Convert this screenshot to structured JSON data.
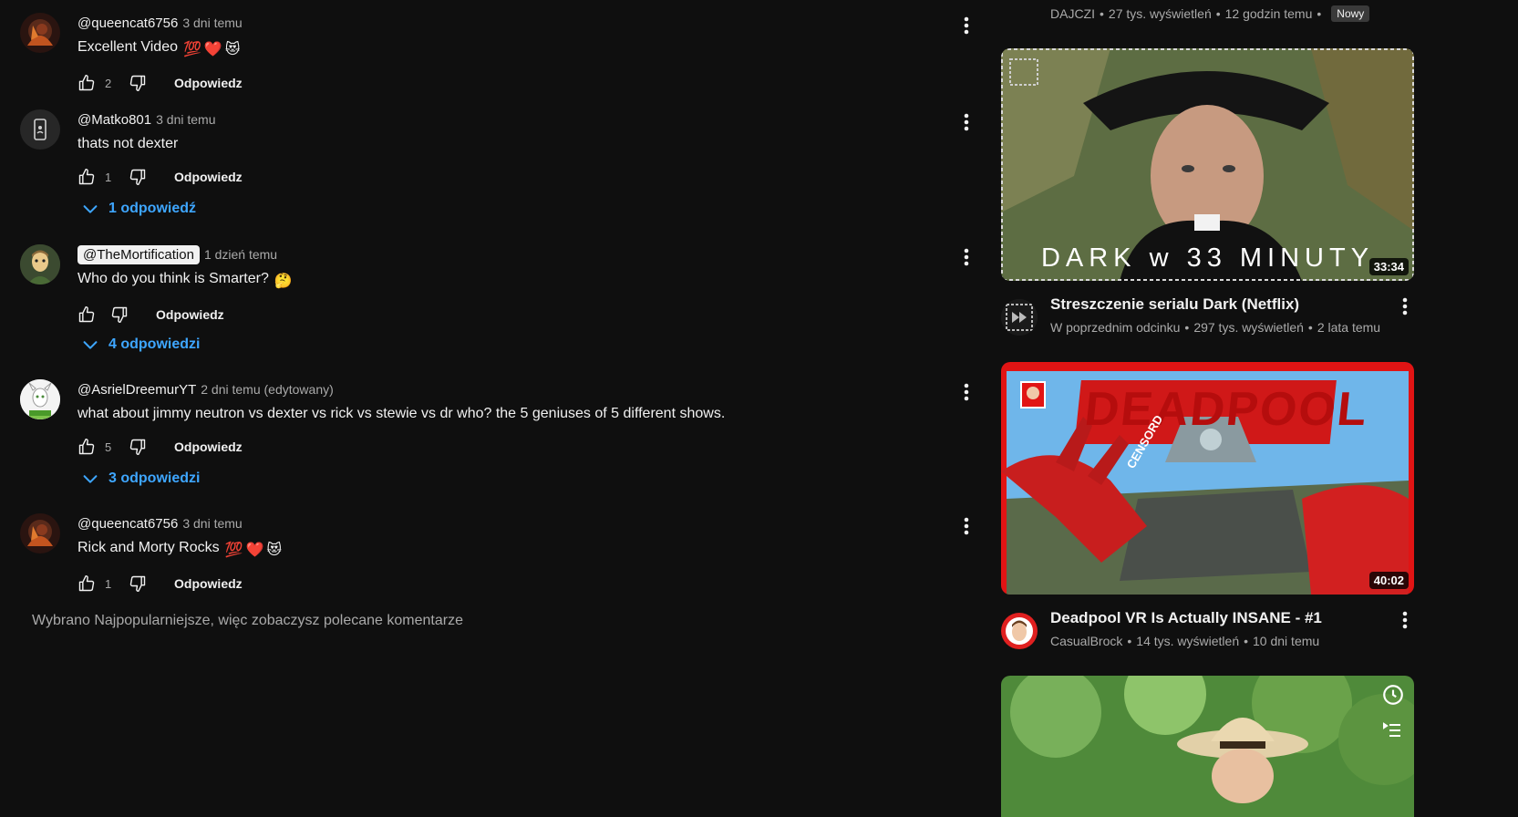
{
  "comments": [
    {
      "author": "@queencat6756",
      "time": "3 dni temu",
      "text": "Excellent Video",
      "emojis": [
        "💯",
        "❤️",
        "😻"
      ],
      "likes": "2",
      "reply_label": "Odpowiedz"
    },
    {
      "author": "@Matko801",
      "time": "3 dni temu",
      "text": "thats not dexter",
      "likes": "1",
      "reply_label": "Odpowiedz",
      "replies_label": "1 odpowiedź"
    },
    {
      "author": "@TheMortification",
      "time": "1 dzień temu",
      "text": "Who do you think is Smarter?",
      "emojis": [
        "🤔"
      ],
      "likes": "",
      "reply_label": "Odpowiedz",
      "replies_label": "4 odpowiedzi"
    },
    {
      "author": "@AsrielDreemurYT",
      "time": "2 dni temu (edytowany)",
      "text": "what about jimmy neutron vs dexter vs rick vs stewie vs dr who? the 5 geniuses of 5 different shows.",
      "likes": "5",
      "reply_label": "Odpowiedz",
      "replies_label": "3 odpowiedzi"
    },
    {
      "author": "@queencat6756",
      "time": "3 dni temu",
      "text": "Rick and Morty Rocks",
      "emojis": [
        "💯",
        "❤️",
        "😻"
      ],
      "likes": "1",
      "reply_label": "Odpowiedz"
    }
  ],
  "footer_note": "Wybrano Najpopularniejsze, więc zobaczysz polecane komentarze",
  "sidebar": {
    "top_meta": {
      "channel": "DAJCZI",
      "views": "27 tys. wyświetleń",
      "age": "12 godzin temu",
      "badge": "Nowy"
    },
    "videos": [
      {
        "thumb_text": "DARK w 33 MINUTY",
        "duration": "33:34",
        "title": "Streszczenie serialu Dark (Netflix)",
        "channel": "W poprzednim odcinku",
        "views": "297 tys. wyświetleń",
        "age": "2 lata temu"
      },
      {
        "thumb_text": "DEADPOOL",
        "thumb_subtext": "CENSORD",
        "duration": "40:02",
        "title": "Deadpool VR Is Actually INSANE - #1",
        "channel": "CasualBrock",
        "views": "14 tys. wyświetleń",
        "age": "10 dni temu"
      }
    ]
  },
  "colors": {
    "background": "#0f0f0f",
    "text": "#f1f1f1",
    "secondary": "#aaaaaa",
    "link": "#3ea6ff"
  },
  "icons": {
    "like": "thumb-up-icon",
    "dislike": "thumb-down-icon",
    "more": "more-vert-icon",
    "expand": "chevron-down-icon",
    "watch_later": "clock-icon",
    "queue": "add-to-queue-icon"
  }
}
